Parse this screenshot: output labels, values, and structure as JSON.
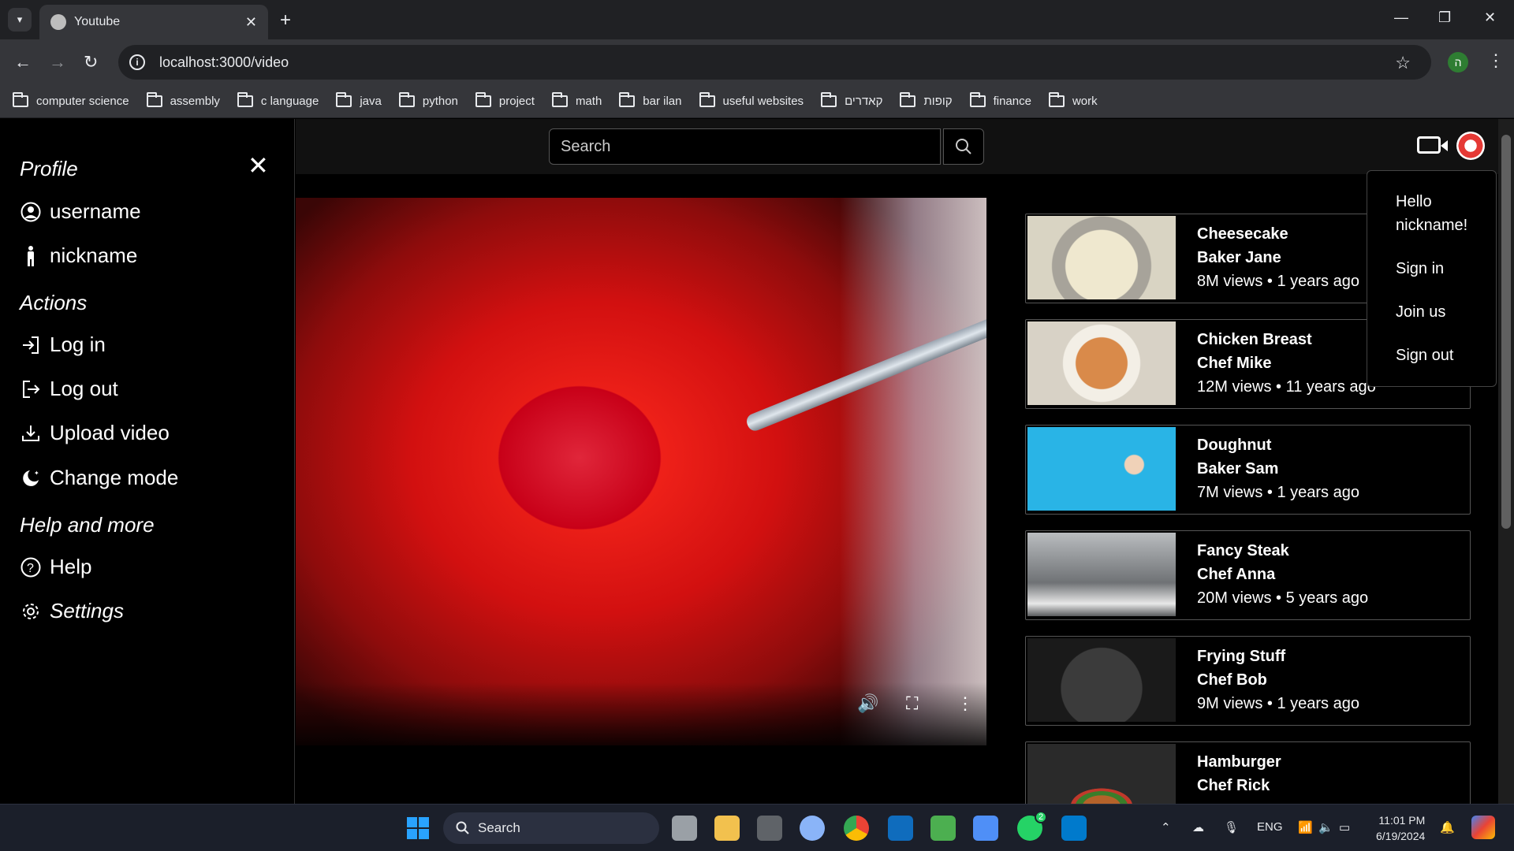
{
  "browser": {
    "tab_title": "Youtube",
    "url": "localhost:3000/video",
    "profile_initial": "ה",
    "bookmarks": [
      "computer science",
      "assembly",
      "c language",
      "java",
      "python",
      "project",
      "math",
      "bar ilan",
      "useful websites",
      "קאדרים",
      "קופות",
      "finance",
      "work"
    ]
  },
  "sidebar": {
    "headings": {
      "profile": "Profile",
      "actions": "Actions",
      "help_more": "Help and more"
    },
    "items": {
      "username": "username",
      "nickname": "nickname",
      "login": "Log in",
      "logout": "Log out",
      "upload": "Upload video",
      "mode": "Change mode",
      "help": "Help",
      "settings": "Settings"
    }
  },
  "topbar": {
    "search_placeholder": "Search"
  },
  "dropdown": {
    "greeting": "Hello nickname!",
    "sign_in": "Sign in",
    "join": "Join us",
    "sign_out": "Sign out"
  },
  "recommendations": [
    {
      "title": "Cheesecake",
      "author": "Baker Jane",
      "meta": "8M views • 1 years ago",
      "thumb_color": "#cfc9b5"
    },
    {
      "title": "Chicken Breast",
      "author": "Chef Mike",
      "meta": "12M views • 11 years ago",
      "thumb_color": "#d6a36b"
    },
    {
      "title": "Doughnut",
      "author": "Baker Sam",
      "meta": "7M views • 1 years ago",
      "thumb_color": "#2bb6e6"
    },
    {
      "title": "Fancy Steak",
      "author": "Chef Anna",
      "meta": "20M views • 5 years ago",
      "thumb_color": "#8a8c8e"
    },
    {
      "title": "Frying Stuff",
      "author": "Chef Bob",
      "meta": "9M views • 1 years ago",
      "thumb_color": "#2a2a2a"
    },
    {
      "title": "Hamburger",
      "author": "Chef Rick",
      "meta": "",
      "thumb_color": "#3a3a3a"
    }
  ],
  "taskbar": {
    "search_label": "Search",
    "language": "ENG",
    "time": "11:01 PM",
    "date": "6/19/2024",
    "whatsapp_badge": "2"
  }
}
